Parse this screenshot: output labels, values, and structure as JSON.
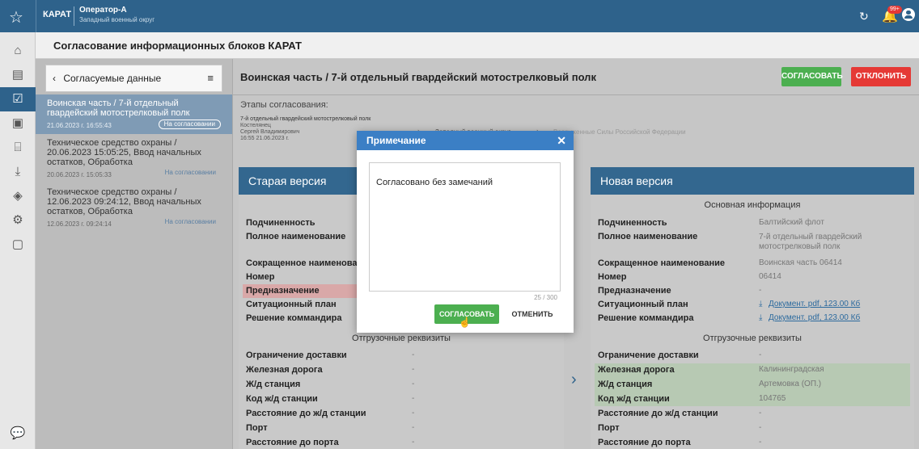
{
  "topbar": {
    "app": "КАРАТ",
    "user": "Оператор-А",
    "district": "Западный военный округ",
    "notifications": "99+"
  },
  "page_title": "Согласование информационных блоков КАРАТ",
  "left": {
    "header": "Согласуемые данные",
    "items": [
      {
        "title": "Воинская часть / 7-й отдельный гвардейский мотострелковый полк",
        "date": "21.06.2023 г. 16:55:43",
        "status": "На согласовании"
      },
      {
        "title": "Техническое средство охраны / 20.06.2023 15:05:25, Ввод начальных остатков, Обработка",
        "date": "20.06.2023 г. 15:05:33",
        "status": "На согласовании"
      },
      {
        "title": "Техническое средство охраны / 12.06.2023 09:24:12, Ввод начальных остатков, Обработка",
        "date": "12.06.2023 г. 09:24:14",
        "status": "На согласовании"
      }
    ]
  },
  "main": {
    "title": "Воинская часть / 7-й отдельный гвардейский мотострелковый полк",
    "approve": "СОГЛАСОВАТЬ",
    "reject": "ОТКЛОНИТЬ",
    "stages_label": "Этапы согласования:",
    "stage1": {
      "name": "7-й отдельный гвардейский мотострелковый полк",
      "person1": "Костелянец",
      "person2": "Сергей Владимирович",
      "date": "16:55 21.06.2023 г."
    },
    "stage2": "Западный военный округ",
    "stage3": "Вооруженные Силы Российской Федерации"
  },
  "old": {
    "title": "Старая версия",
    "section2": "Отгрузочные реквизиты",
    "rows": [
      "Подчиненность",
      "Полное наименование",
      "Сокращенное наименование",
      "Номер",
      "Предназначение",
      "Ситуационный план",
      "Решение коммандира"
    ],
    "rows2": [
      {
        "label": "Ограничение доставки",
        "value": "-"
      },
      {
        "label": "Железная дорога",
        "value": "-"
      },
      {
        "label": "Ж/д станция",
        "value": "-"
      },
      {
        "label": "Код ж/д станции",
        "value": "-"
      },
      {
        "label": "Расстояние до ж/д станции",
        "value": "-"
      },
      {
        "label": "Порт",
        "value": "-"
      },
      {
        "label": "Расстояние до порта",
        "value": "-"
      }
    ]
  },
  "new": {
    "title": "Новая версия",
    "section1": "Основная информация",
    "section2": "Отгрузочные реквизиты",
    "rows": [
      {
        "label": "Подчиненность",
        "value": "Балтийский флот"
      },
      {
        "label": "Полное наименование",
        "value": "7-й отдельный гвардейский мотострелковый полк"
      },
      {
        "label": "Сокращенное наименование",
        "value": "Воинская часть 06414"
      },
      {
        "label": "Номер",
        "value": "06414"
      },
      {
        "label": "Предназначение",
        "value": "-"
      },
      {
        "label": "Ситуационный план",
        "value": "Документ. pdf, 123.00 Кб"
      },
      {
        "label": "Решение коммандира",
        "value": "Документ. pdf, 123.00 Кб"
      }
    ],
    "rows2": [
      {
        "label": "Ограничение доставки",
        "value": "-"
      },
      {
        "label": "Железная дорога",
        "value": "Калининградская"
      },
      {
        "label": "Ж/д станция",
        "value": "Артемовка (ОП.)"
      },
      {
        "label": "Код ж/д станции",
        "value": "104765"
      },
      {
        "label": "Расстояние до ж/д станции",
        "value": "-"
      },
      {
        "label": "Порт",
        "value": "-"
      },
      {
        "label": "Расстояние до порта",
        "value": "-"
      }
    ]
  },
  "modal": {
    "title": "Примечание",
    "text": "Согласовано без замечаний",
    "counter": "25 / 300",
    "ok": "СОГЛАСОВАТЬ",
    "cancel": "ОТМЕНИТЬ"
  },
  "colors": {
    "header": "#2e628b",
    "approve": "#4caf50",
    "reject": "#e53935",
    "modal_head": "#3b7fc5"
  }
}
